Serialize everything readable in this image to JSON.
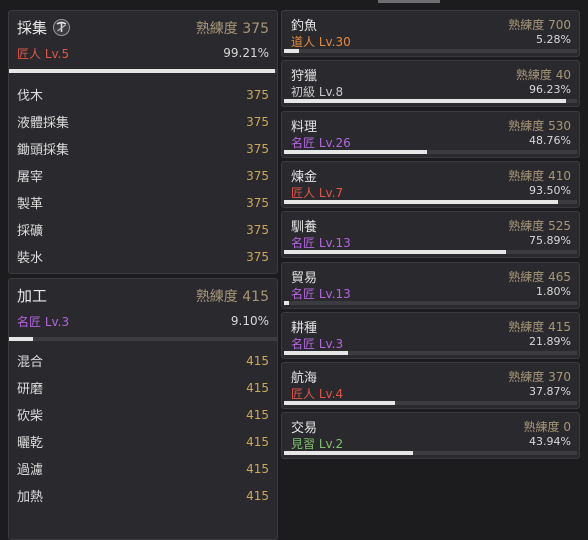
{
  "gathering": {
    "title": "採集",
    "prof_label": "熟練度",
    "prof_value": "375",
    "level": "匠人 Lv.5",
    "level_color": "#e05548",
    "percent": "99.21%",
    "progress": 0.9921,
    "items": [
      {
        "name": "伐木",
        "value": "375"
      },
      {
        "name": "液體採集",
        "value": "375"
      },
      {
        "name": "鋤頭採集",
        "value": "375"
      },
      {
        "name": "屠宰",
        "value": "375"
      },
      {
        "name": "製革",
        "value": "375"
      },
      {
        "name": "採礦",
        "value": "375"
      },
      {
        "name": "裝水",
        "value": "375"
      }
    ]
  },
  "processing": {
    "title": "加工",
    "prof_label": "熟練度",
    "prof_value": "415",
    "level": "名匠 Lv.3",
    "level_color": "#b364e0",
    "percent": "9.10%",
    "progress": 0.091,
    "items": [
      {
        "name": "混合",
        "value": "415"
      },
      {
        "name": "研磨",
        "value": "415"
      },
      {
        "name": "砍柴",
        "value": "415"
      },
      {
        "name": "曬乾",
        "value": "415"
      },
      {
        "name": "過濾",
        "value": "415"
      },
      {
        "name": "加熱",
        "value": "415"
      }
    ]
  },
  "skills": [
    {
      "name": "釣魚",
      "prof": "熟練度 700",
      "level": "道人 Lv.30",
      "lvcls": "c-orange",
      "percent": "5.28%",
      "progress": 0.0528
    },
    {
      "name": "狩獵",
      "prof": "熟練度 40",
      "level": "初級 Lv.8",
      "lvcls": "c-grey",
      "percent": "96.23%",
      "progress": 0.9623
    },
    {
      "name": "料理",
      "prof": "熟練度 530",
      "level": "名匠 Lv.26",
      "lvcls": "c-purple",
      "percent": "48.76%",
      "progress": 0.4876
    },
    {
      "name": "煉金",
      "prof": "熟練度 410",
      "level": "匠人 Lv.7",
      "lvcls": "c-red",
      "percent": "93.50%",
      "progress": 0.935
    },
    {
      "name": "馴養",
      "prof": "熟練度 525",
      "level": "名匠 Lv.13",
      "lvcls": "c-purple",
      "percent": "75.89%",
      "progress": 0.7589
    },
    {
      "name": "貿易",
      "prof": "熟練度 465",
      "level": "名匠 Lv.13",
      "lvcls": "c-purple",
      "percent": "1.80%",
      "progress": 0.018
    },
    {
      "name": "耕種",
      "prof": "熟練度 415",
      "level": "名匠 Lv.3",
      "lvcls": "c-purple",
      "percent": "21.89%",
      "progress": 0.2189
    },
    {
      "name": "航海",
      "prof": "熟練度 370",
      "level": "匠人 Lv.4",
      "lvcls": "c-red",
      "percent": "37.87%",
      "progress": 0.3787
    },
    {
      "name": "交易",
      "prof": "熟練度 0",
      "level": "見習 Lv.2",
      "lvcls": "c-green",
      "percent": "43.94%",
      "progress": 0.4394
    }
  ]
}
